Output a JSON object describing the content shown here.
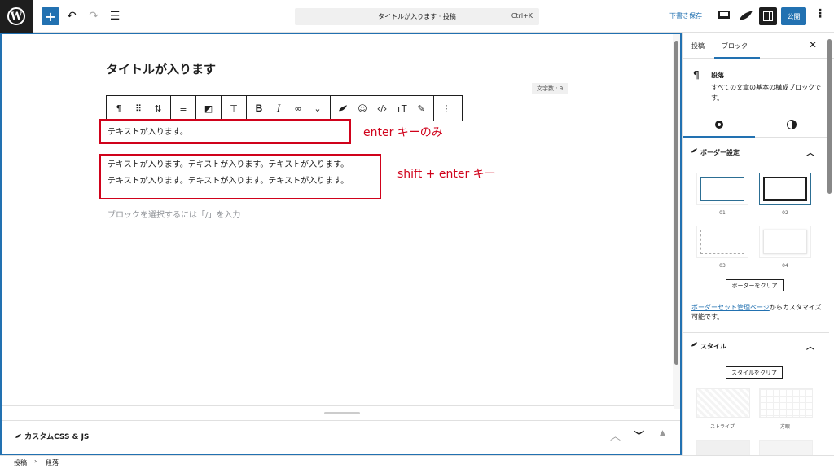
{
  "topbar": {
    "doc_title": "タイトルが入ります · 投稿",
    "shortcut": "Ctrl+K",
    "save_draft": "下書き保存",
    "publish": "公開"
  },
  "editor": {
    "post_title": "タイトルが入ります",
    "char_count": "文字数 : 9",
    "paragraph1": "テキストが入ります。",
    "paragraph2_line1": "テキストが入ります。テキストが入ります。テキストが入ります。",
    "paragraph2_line2": "テキストが入ります。テキストが入ります。テキストが入ります。",
    "placeholder": "ブロックを選択するには「/」を入力",
    "annotation1": "enter キーのみ",
    "annotation2": "shift + enter キー",
    "annotation_color": "#d0021b"
  },
  "toolbar": {
    "icons": [
      "paragraph-icon",
      "drag-handle-icon",
      "move-updown-icon",
      "align-icon",
      "ai-icon",
      "format-brush-icon",
      "bold-icon",
      "italic-icon",
      "link-icon",
      "chevron-down-icon",
      "leaf-icon",
      "emoji-icon",
      "code-icon",
      "text-size-icon",
      "highlight-icon",
      "more-options-icon"
    ]
  },
  "meta_panel": {
    "title": "カスタムCSS & JS"
  },
  "sidebar": {
    "tab_post": "投稿",
    "tab_block": "ブロック",
    "block_name": "段落",
    "block_desc": "すべての文章の基本の構成ブロックです。",
    "border_panel_title": "ボーダー設定",
    "presets": [
      "01",
      "02",
      "03",
      "04"
    ],
    "clear_border": "ボーダーをクリア",
    "note_link": "ボーダーセット管理ページ",
    "note_rest": "からカスタマイズ可能です。",
    "style_panel_title": "スタイル",
    "clear_style": "スタイルをクリア",
    "styles": [
      "ストライプ",
      "方眼"
    ]
  },
  "footer": {
    "crumb1": "投稿",
    "crumb2": "段落"
  },
  "colors": {
    "accent": "#2271b1",
    "dark": "#1e1e1e"
  }
}
